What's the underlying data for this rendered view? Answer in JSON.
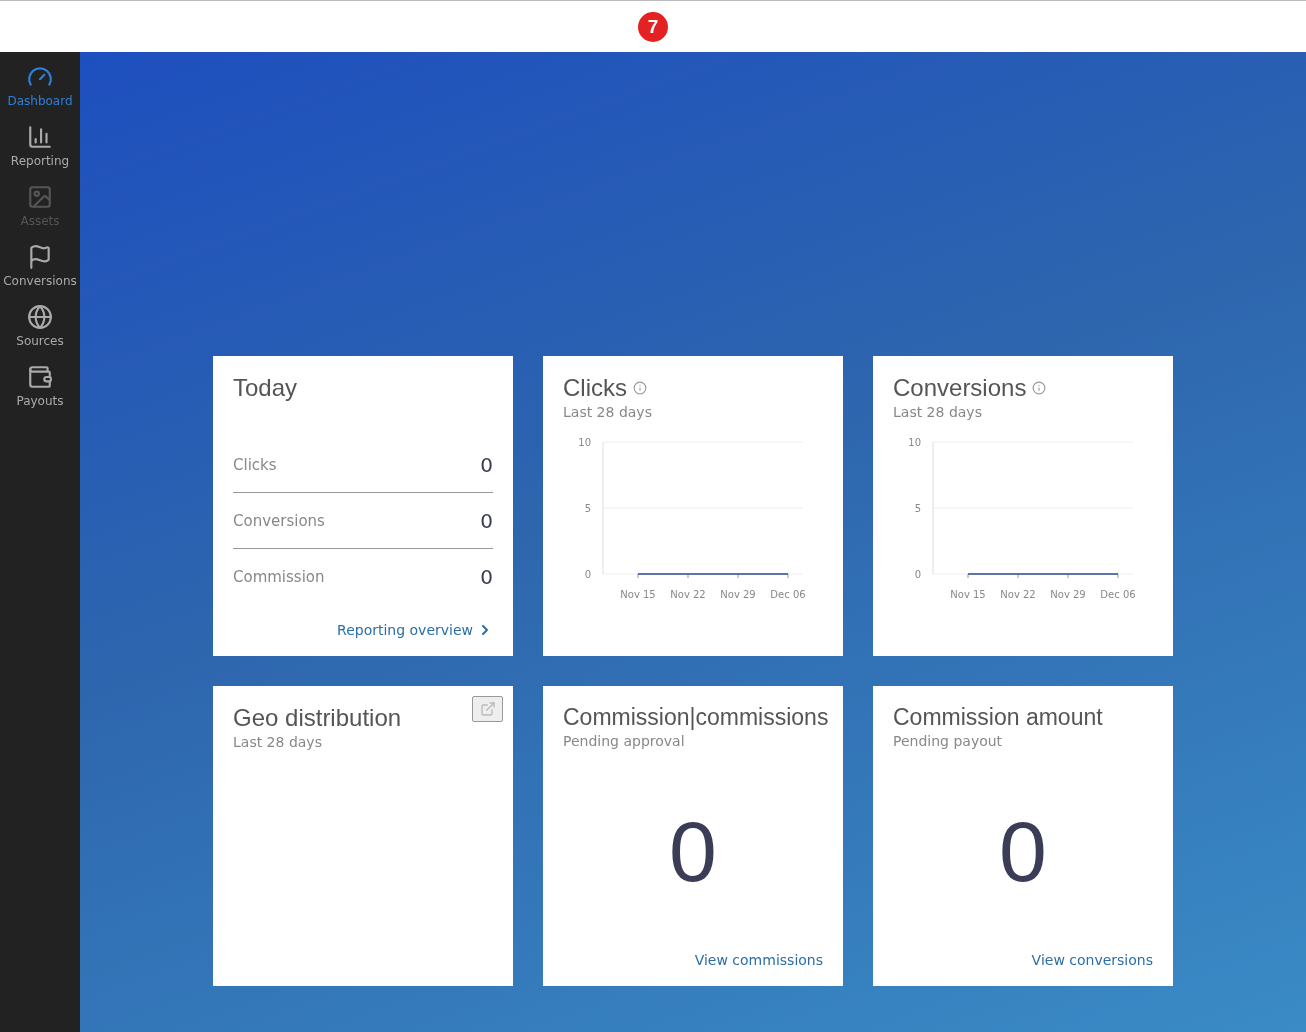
{
  "top_bar": {
    "logo_text": "7"
  },
  "sidebar": {
    "items": [
      {
        "label": "Dashboard",
        "kind": "gauge",
        "selected": true,
        "disabled": false
      },
      {
        "label": "Reporting",
        "kind": "chart",
        "selected": false,
        "disabled": false
      },
      {
        "label": "Assets",
        "kind": "image",
        "selected": false,
        "disabled": true
      },
      {
        "label": "Conversions",
        "kind": "flag",
        "selected": false,
        "disabled": false
      },
      {
        "label": "Sources",
        "kind": "globe",
        "selected": false,
        "disabled": false
      },
      {
        "label": "Payouts",
        "kind": "wallet",
        "selected": false,
        "disabled": false
      }
    ]
  },
  "cards": [
    {
      "kind": "today",
      "title": "Today",
      "rows": [
        {
          "label": "Clicks",
          "value": "0"
        },
        {
          "label": "Conversions",
          "value": "0"
        },
        {
          "label": "Commission",
          "value": "0"
        }
      ],
      "link": "Reporting overview"
    },
    {
      "kind": "chart",
      "title": "Clicks",
      "subtitle": "Last 28 days",
      "chart_data": {
        "type": "line",
        "categories": [
          "Nov 15",
          "Nov 22",
          "Nov 29",
          "Dec 06"
        ],
        "series": [
          {
            "color": "#2b4a8c",
            "values": [
              0,
              0,
              0,
              0
            ]
          }
        ],
        "ylim": [
          0,
          10
        ],
        "yticks": [
          0,
          5,
          10
        ]
      }
    },
    {
      "kind": "chart",
      "title": "Conversions",
      "subtitle": "Last 28 days",
      "chart_data": {
        "type": "line",
        "categories": [
          "Nov 15",
          "Nov 22",
          "Nov 29",
          "Dec 06"
        ],
        "series": [
          {
            "color": "#2b4a8c",
            "values": [
              0,
              0,
              0,
              0
            ]
          }
        ],
        "ylim": [
          0,
          10
        ],
        "yticks": [
          0,
          5,
          10
        ]
      }
    },
    {
      "kind": "geo",
      "title": "Geo distribution",
      "subtitle": "Last 28 days"
    },
    {
      "kind": "big",
      "title": "Commission|commissions",
      "subtitle": "Pending approval",
      "value": "0",
      "link": "View commissions"
    },
    {
      "kind": "big",
      "title": "Commission amount",
      "subtitle": "Pending payout",
      "value": "0",
      "link": "View conversions"
    }
  ]
}
